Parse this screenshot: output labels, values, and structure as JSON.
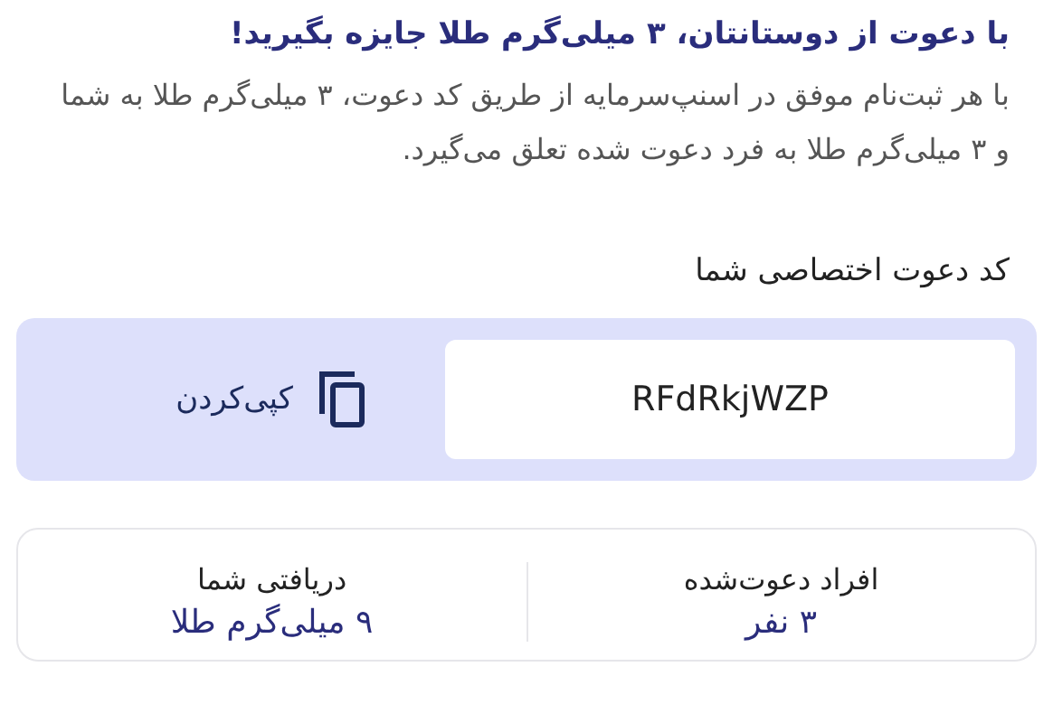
{
  "heading": "با دعوت از دوستانتان، ۳ میلی‌گرم طلا جایزه بگیرید!",
  "description": "با هر ثبت‌نام موفق در اسنپ‌سرمایه از طریق کد دعوت، ۳ میلی‌گرم طلا به شما و ۳ میلی‌گرم طلا به فرد دعوت شده تعلق می‌گیرد.",
  "invite_code": {
    "label": "کد دعوت اختصاصی شما",
    "code": "RFdRkjWZP",
    "copy_button": "کپی‌کردن"
  },
  "stats": [
    {
      "label": "افراد دعوت‌شده",
      "value": "۳ نفر"
    },
    {
      "label": "دریافتی شما",
      "value": "۹ میلی‌گرم طلا"
    }
  ]
}
